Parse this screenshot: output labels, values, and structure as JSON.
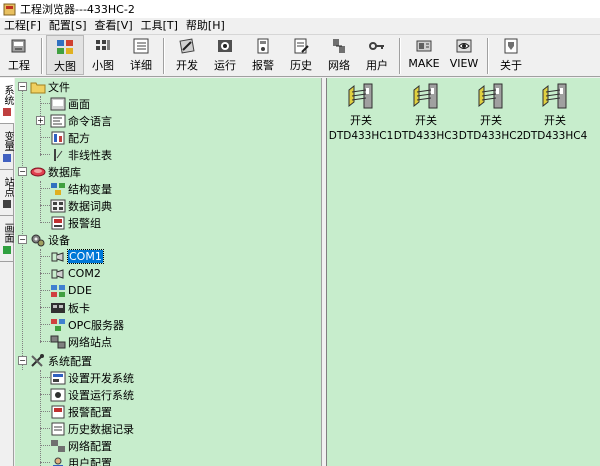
{
  "window": {
    "title": "工程浏览器---433HC-2"
  },
  "menu": [
    "工程[F]",
    "配置[S]",
    "查看[V]",
    "工具[T]",
    "帮助[H]"
  ],
  "toolbar": {
    "items": [
      {
        "label": "工程",
        "icon": "project-icon"
      },
      {
        "label": "大图",
        "icon": "large-icons-icon"
      },
      {
        "label": "小图",
        "icon": "small-icons-icon"
      },
      {
        "label": "详细",
        "icon": "details-icon"
      },
      {
        "label": "开发",
        "icon": "develop-icon"
      },
      {
        "label": "运行",
        "icon": "run-icon"
      },
      {
        "label": "报警",
        "icon": "alarm-icon"
      },
      {
        "label": "历史",
        "icon": "history-icon"
      },
      {
        "label": "网络",
        "icon": "network-icon"
      },
      {
        "label": "用户",
        "icon": "user-key-icon"
      },
      {
        "label": "MAKE",
        "icon": "make-icon"
      },
      {
        "label": "VIEW",
        "icon": "view-icon"
      },
      {
        "label": "关于",
        "icon": "about-icon"
      }
    ],
    "active": "大图"
  },
  "side_tabs": [
    "系统",
    "变量",
    "站点",
    "画面"
  ],
  "tree": {
    "root_file": "文件",
    "file_children": [
      "画面",
      "命令语言",
      "配方",
      "非线性表"
    ],
    "root_db": "数据库",
    "db_children": [
      "结构变量",
      "数据词典",
      "报警组"
    ],
    "root_device": "设备",
    "device_children": [
      "COM1",
      "COM2",
      "DDE",
      "板卡",
      "OPC服务器",
      "网络站点"
    ],
    "selected": "COM1",
    "root_system": "系统配置",
    "system_children": [
      "设置开发系统",
      "设置运行系统",
      "报警配置",
      "历史数据记录",
      "网络配置",
      "用户配置"
    ]
  },
  "devices": [
    {
      "type": "开关",
      "name": "DTD433HC1"
    },
    {
      "type": "开关",
      "name": "DTD433HC3"
    },
    {
      "type": "开关",
      "name": "DTD433HC2"
    },
    {
      "type": "开关",
      "name": "DTD433HC4"
    }
  ],
  "colors": {
    "pane_bg": "#c7edcc",
    "selection": "#0078d7",
    "chrome": "#f0f0f0"
  }
}
